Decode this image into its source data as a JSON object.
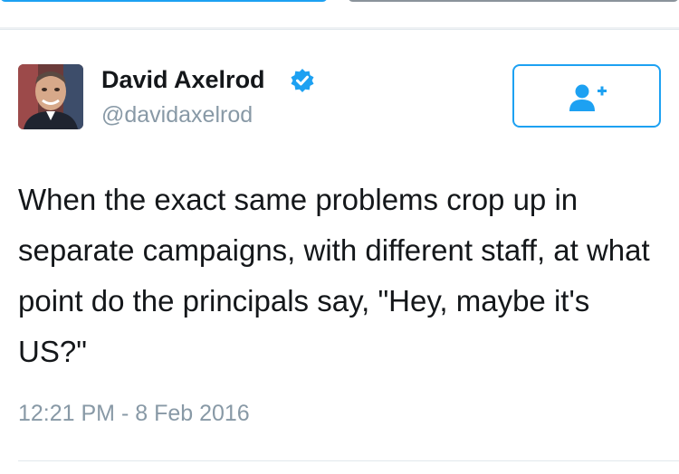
{
  "tweet": {
    "author_name": "David Axelrod",
    "author_handle": "@davidaxelrod",
    "verified": true,
    "text": "When the exact same problems crop up in separate campaigns, with different staff, at what point do the principals say, \"Hey, maybe it's US?\"",
    "timestamp": "12:21 PM - 8 Feb 2016"
  },
  "icons": {
    "verified": "verified-badge-icon",
    "follow": "add-user-icon"
  },
  "colors": {
    "accent": "#1da1f2",
    "text": "#14171a",
    "muted": "#8899a6",
    "divider": "#e1e8ed"
  }
}
